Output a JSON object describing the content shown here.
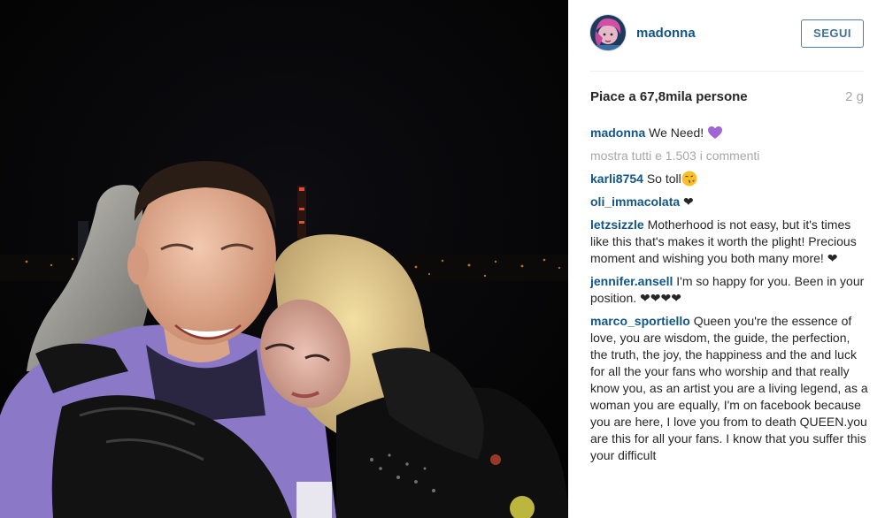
{
  "profile": {
    "username": "madonna",
    "follow_label": "SEGUI"
  },
  "post": {
    "likes": "Piace a 67,8mila persone",
    "time": "2 g",
    "caption_user": "madonna",
    "caption_text": "We Need! ",
    "view_all_comments": "mostra tutti e 1.503 i commenti"
  },
  "comments": [
    {
      "user": "karli8754",
      "text": "So toll"
    },
    {
      "user": "oli_immacolata",
      "text": "❤"
    },
    {
      "user": "letzsizzle",
      "text": "Motherhood is not easy, but it's times like this that's makes it worth the plight! Precious moment and wishing you both many more! ❤"
    },
    {
      "user": "jennifer.ansell",
      "text": "I'm so happy for you. Been in your position. ❤❤❤❤"
    },
    {
      "user": "marco_sportiello",
      "text": "Queen you're the essence of love, you are wisdom, the guide, the perfection, the truth, the joy, the happiness and the and luck for all the your fans who worship and that really know you, as an artist you are a living legend, as a woman you are equally, I'm on facebook because you are here, I love you from to death QUEEN.you are this for all your fans. I know that you suffer this your difficult"
    }
  ],
  "colors": {
    "link_blue": "#125688",
    "follow_blue": "#3f729b",
    "muted_gray": "#a5a7aa",
    "purple_heart": "#a066d3"
  },
  "icons": {
    "purple_heart": "purple-heart-emoji",
    "kiss_face": "face-blowing-kiss-emoji"
  }
}
